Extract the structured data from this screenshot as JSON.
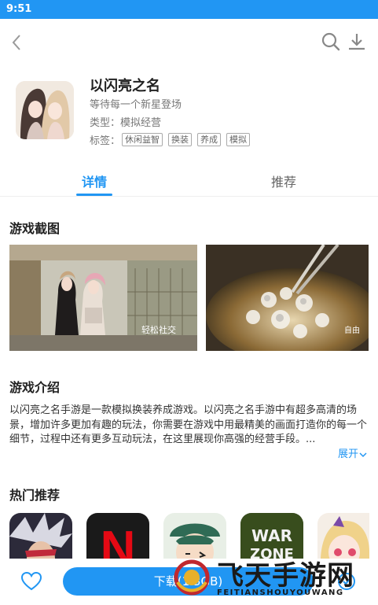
{
  "status_bar": {
    "time": "9:51"
  },
  "app": {
    "name": "以闪亮之名",
    "slogan": "等待每一个新星登场",
    "type_label": "类型：",
    "type_value": "模拟经营",
    "tags_label": "标签：",
    "tags": [
      "休闲益智",
      "换装",
      "养成",
      "模拟"
    ]
  },
  "tabs": [
    {
      "label": "详情",
      "active": true
    },
    {
      "label": "推荐",
      "active": false
    }
  ],
  "screenshots": {
    "title": "游戏截图",
    "items": [
      {
        "caption": "轻松社交"
      },
      {
        "caption": "自由"
      }
    ]
  },
  "intro": {
    "title": "游戏介绍",
    "text": "以闪亮之名手游是一款模拟换装养成游戏。以闪亮之名手游中有超多高清的场景，增加许多更加有趣的玩法，你需要在游戏中用最精美的画面打造你的每一个细节，过程中还有更多互动玩法，在这里展现你高强的经营手段。...",
    "expand_label": "展开"
  },
  "hot": {
    "title": "热门推荐",
    "items": [
      {
        "icon": "anime-fighter-app-icon"
      },
      {
        "icon": "netflix-app-icon",
        "letter": "N"
      },
      {
        "icon": "cartoon-character-app-icon"
      },
      {
        "icon": "warzone-app-icon",
        "line1": "WAR",
        "line2": "ZONE"
      },
      {
        "icon": "anime-girl-app-icon"
      }
    ]
  },
  "bottom": {
    "download_label": "下载(1.3GB)"
  },
  "watermark": {
    "title": "飞天手游网",
    "subtitle": "FEITIANSHOUYOUWANG"
  },
  "colors": {
    "accent": "#2196f3",
    "tag_border": "#aaaaaa"
  }
}
